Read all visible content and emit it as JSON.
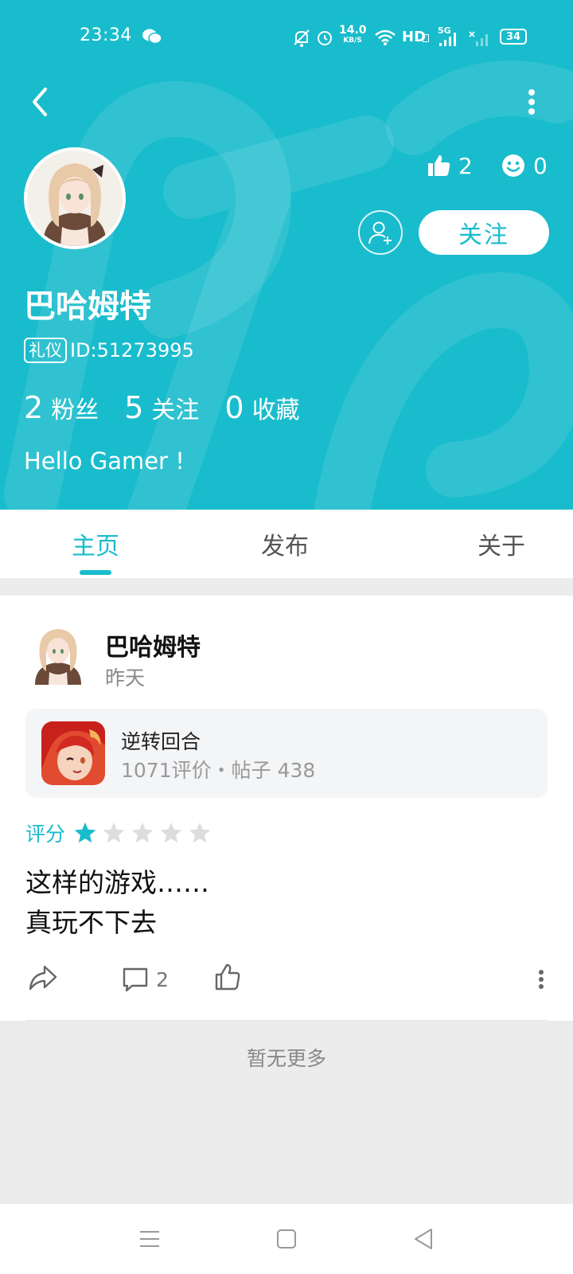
{
  "status_bar": {
    "time": "23:34",
    "network_speed_value": "14.0",
    "network_speed_unit": "KB/S",
    "hd_label": "HD",
    "net_type": "5G",
    "battery": "34"
  },
  "profile": {
    "username": "巴哈姆特",
    "id_tag": "礼仪",
    "id_text": "ID:51273995",
    "likes": "2",
    "smiles": "0",
    "follow_label": "关注",
    "bio": "Hello Gamer !",
    "counts": [
      {
        "value": "2",
        "label": "粉丝"
      },
      {
        "value": "5",
        "label": "关注"
      },
      {
        "value": "0",
        "label": "收藏"
      }
    ]
  },
  "tabs": [
    {
      "label": "主页",
      "active": true
    },
    {
      "label": "发布",
      "active": false
    },
    {
      "label": "关于",
      "active": false
    }
  ],
  "post": {
    "author": "巴哈姆特",
    "time": "昨天",
    "game": {
      "name": "逆转回合",
      "meta": "1071评价・帖子 438"
    },
    "rating_label": "评分",
    "rating_value": 1,
    "rating_max": 5,
    "text_line1": "这样的游戏……",
    "text_line2": "真玩不下去",
    "comment_count": "2"
  },
  "footer_note": "暂无更多",
  "colors": {
    "accent": "#19bccc",
    "star_empty": "#dddddd"
  }
}
